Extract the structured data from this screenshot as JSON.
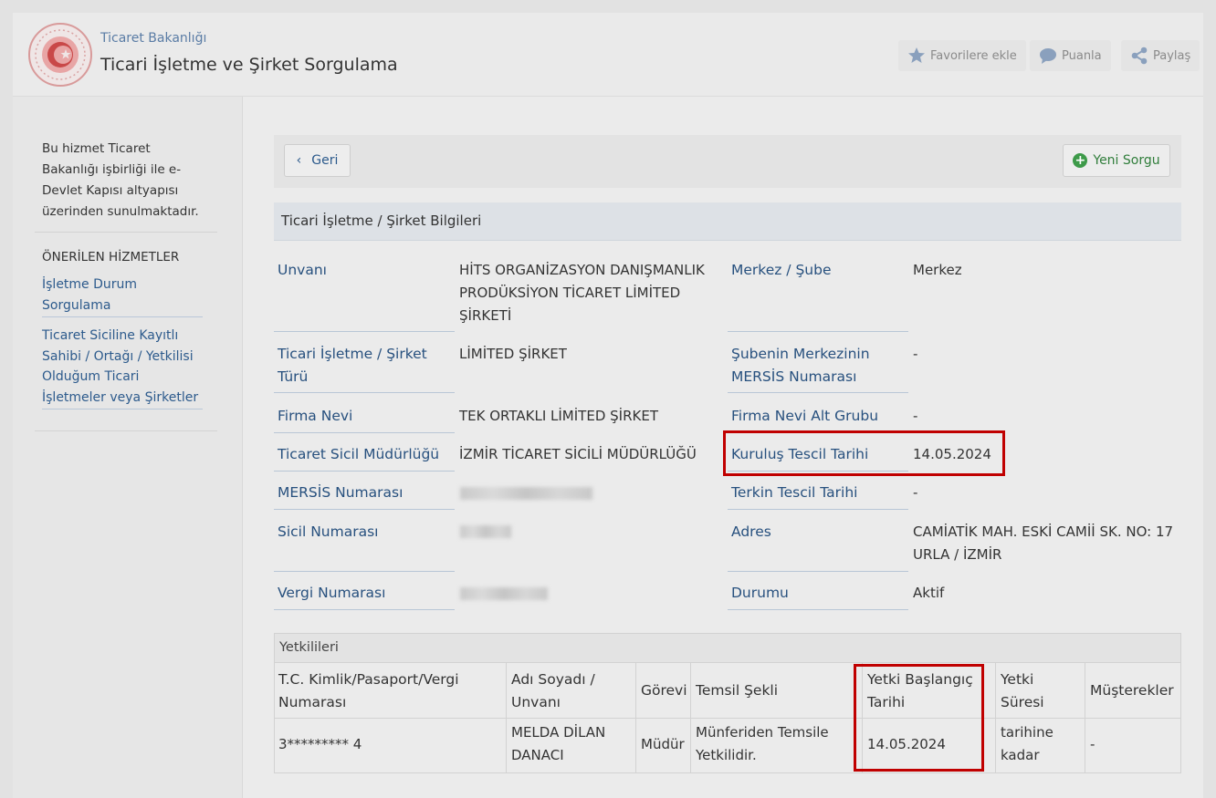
{
  "header": {
    "ministry": "Ticaret Bakanlığı",
    "title": "Ticari İşletme ve Şirket Sorgulama",
    "favorites": "Favorilere ekle",
    "rate": "Puanla",
    "share": "Paylaş"
  },
  "sidebar": {
    "intro": "Bu hizmet Ticaret Bakanlığı işbirliği ile e-Devlet Kapısı altyapısı üzerinden sunulmaktadır.",
    "heading": "ÖNERİLEN HİZMETLER",
    "links": [
      "İşletme Durum Sorgulama",
      "Ticaret Siciline Kayıtlı Sahibi / Ortağı / Yetkilisi Olduğum Ticari İşletmeler veya Şirketler"
    ]
  },
  "toolbar": {
    "back": "Geri",
    "new_query": "Yeni Sorgu"
  },
  "info": {
    "heading": "Ticari İşletme / Şirket Bilgileri",
    "rows": [
      {
        "l1": "Unvanı",
        "v1": "HİTS ORGANİZASYON DANIŞMANLIK PRODÜKSİYON TİCARET LİMİTED ŞİRKETİ",
        "l2": "Merkez / Şube",
        "v2": "Merkez"
      },
      {
        "l1": "Ticari İşletme / Şirket Türü",
        "v1": "LİMİTED ŞİRKET",
        "l2": "Şubenin Merkezinin MERSİS Numarası",
        "v2": "-"
      },
      {
        "l1": "Firma Nevi",
        "v1": "TEK ORTAKLI LİMİTED ŞİRKET",
        "l2": "Firma Nevi Alt Grubu",
        "v2": "-"
      },
      {
        "l1": "Ticaret Sicil Müdürlüğü",
        "v1": "İZMİR TİCARET SİCİLİ MÜDÜRLÜĞÜ",
        "l2": "Kuruluş Tescil Tarihi",
        "v2": "14.05.2024"
      },
      {
        "l1": "MERSİS Numarası",
        "v1": "",
        "l2": "Terkin Tescil Tarihi",
        "v2": "-"
      },
      {
        "l1": "Sicil Numarası",
        "v1": "",
        "l2": "Adres",
        "v2": "CAMİATİK MAH. ESKİ CAMİİ SK. NO: 17 URLA / İZMİR"
      },
      {
        "l1": "Vergi Numarası",
        "v1": "",
        "l2": "Durumu",
        "v2": "Aktif"
      }
    ]
  },
  "officials": {
    "heading": "Yetkilileri",
    "columns": [
      "T.C. Kimlik/Pasaport/Vergi Numarası",
      "Adı Soyadı / Unvanı",
      "Görevi",
      "Temsil Şekli",
      "Yetki Başlangıç Tarihi",
      "Yetki Süresi",
      "Müşterekler"
    ],
    "rows": [
      [
        "3********* 4",
        "MELDA DİLAN DANACI",
        "Müdür",
        "Münferiden Temsile Yetkilidir.",
        "14.05.2024",
        "tarihine kadar",
        "-"
      ]
    ]
  },
  "colors": {
    "label": "#27507e",
    "highlight": "#c00000",
    "accent_green": "#3d9a49"
  }
}
